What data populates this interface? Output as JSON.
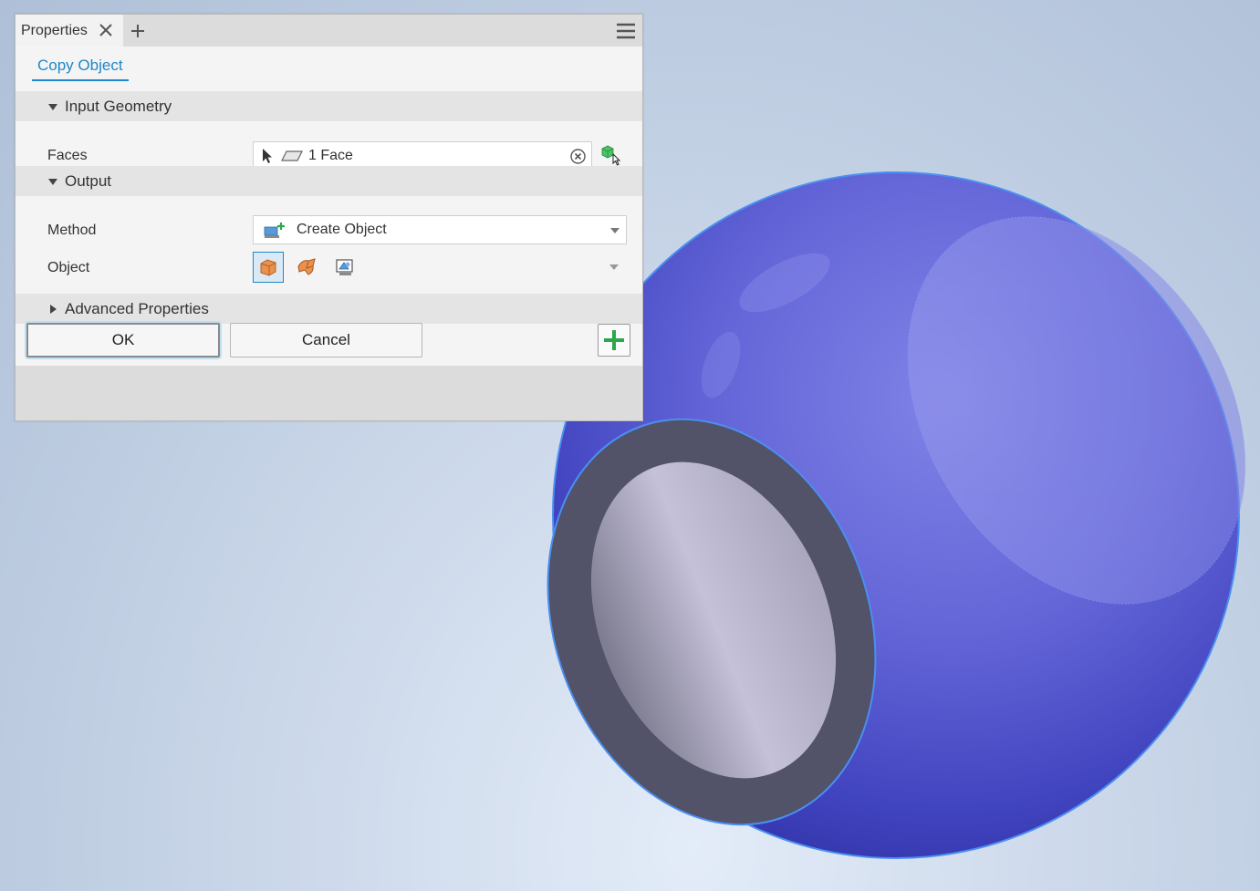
{
  "panel": {
    "tab_label": "Properties",
    "subtab_label": "Copy Object"
  },
  "sections": {
    "input_geometry": "Input Geometry",
    "output": "Output",
    "advanced": "Advanced Properties"
  },
  "fields": {
    "faces_label": "Faces",
    "faces_value": "1 Face",
    "method_label": "Method",
    "method_value": "Create Object",
    "object_label": "Object"
  },
  "buttons": {
    "ok": "OK",
    "cancel": "Cancel"
  },
  "colors": {
    "accent": "#1e88c8",
    "model_body": "#5a5fd6",
    "bore_face": "#525268",
    "add_green": "#2aa84a"
  },
  "icons": {
    "tab_close": "close-icon",
    "tab_add": "plus-icon",
    "menu": "hamburger-icon",
    "select_cursor": "cursor-arrow-icon",
    "face": "face-icon",
    "clear": "clear-circle-icon",
    "select_other": "select-other-icon",
    "method": "create-object-icon",
    "object_solid": "solid-body-icon",
    "object_surface": "surface-body-icon",
    "object_composite": "composite-icon",
    "add": "plus-icon"
  }
}
